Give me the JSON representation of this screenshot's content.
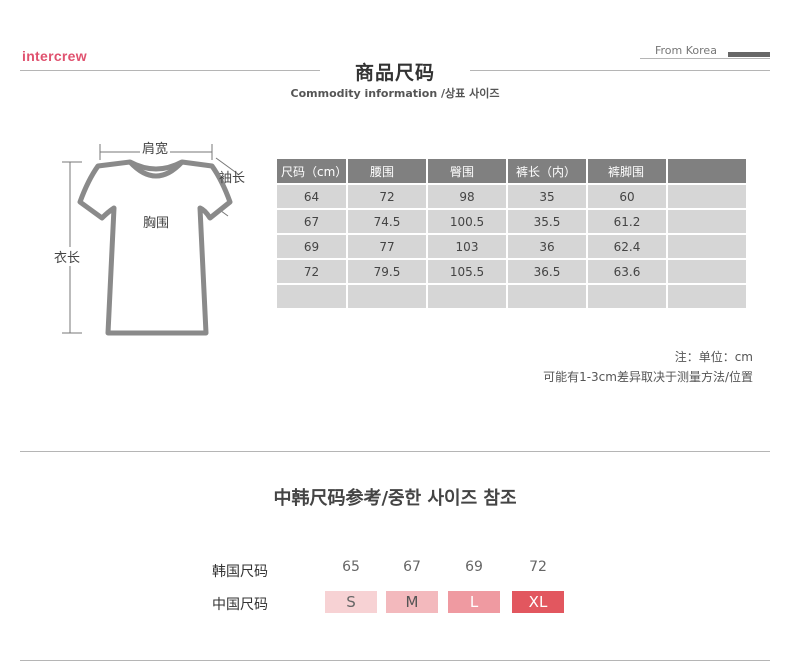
{
  "header": {
    "logo": "intercrew",
    "from_korea": "From Korea",
    "title": "商品尺码",
    "subtitle": "Commodity information  /상표 사이즈"
  },
  "diagram": {
    "shoulder_label": "肩宽",
    "sleeve_label": "袖长",
    "chest_label": "胸围",
    "length_label": "衣长"
  },
  "size_table": {
    "headers": [
      "尺码（cm）",
      "腰围",
      "臀围",
      "裤长（内）",
      "裤脚围",
      ""
    ],
    "rows": [
      [
        "64",
        "72",
        "98",
        "35",
        "60",
        ""
      ],
      [
        "67",
        "74.5",
        "100.5",
        "35.5",
        "61.2",
        ""
      ],
      [
        "69",
        "77",
        "103",
        "36",
        "62.4",
        ""
      ],
      [
        "72",
        "79.5",
        "105.5",
        "36.5",
        "63.6",
        ""
      ],
      [
        "",
        "",
        "",
        "",
        "",
        ""
      ]
    ]
  },
  "notes": {
    "unit": "注：单位：cm",
    "tolerance": "可能有1-3cm差异取决于测量方法/位置"
  },
  "reference": {
    "title": "中韩尺码参考/중한 사이즈 참조",
    "korea_label": "韩国尺码",
    "china_label": "中国尺码",
    "korea_sizes": [
      "65",
      "67",
      "69",
      "72"
    ],
    "china_sizes": [
      "S",
      "M",
      "L",
      "XL"
    ],
    "china_colors": [
      "#f7d2d4",
      "#f3b9bd",
      "#ef9aa1",
      "#e2575f"
    ]
  },
  "colors": {
    "brand": "#e0526f",
    "table_header": "#808080",
    "table_cell": "#d6d6d6"
  }
}
